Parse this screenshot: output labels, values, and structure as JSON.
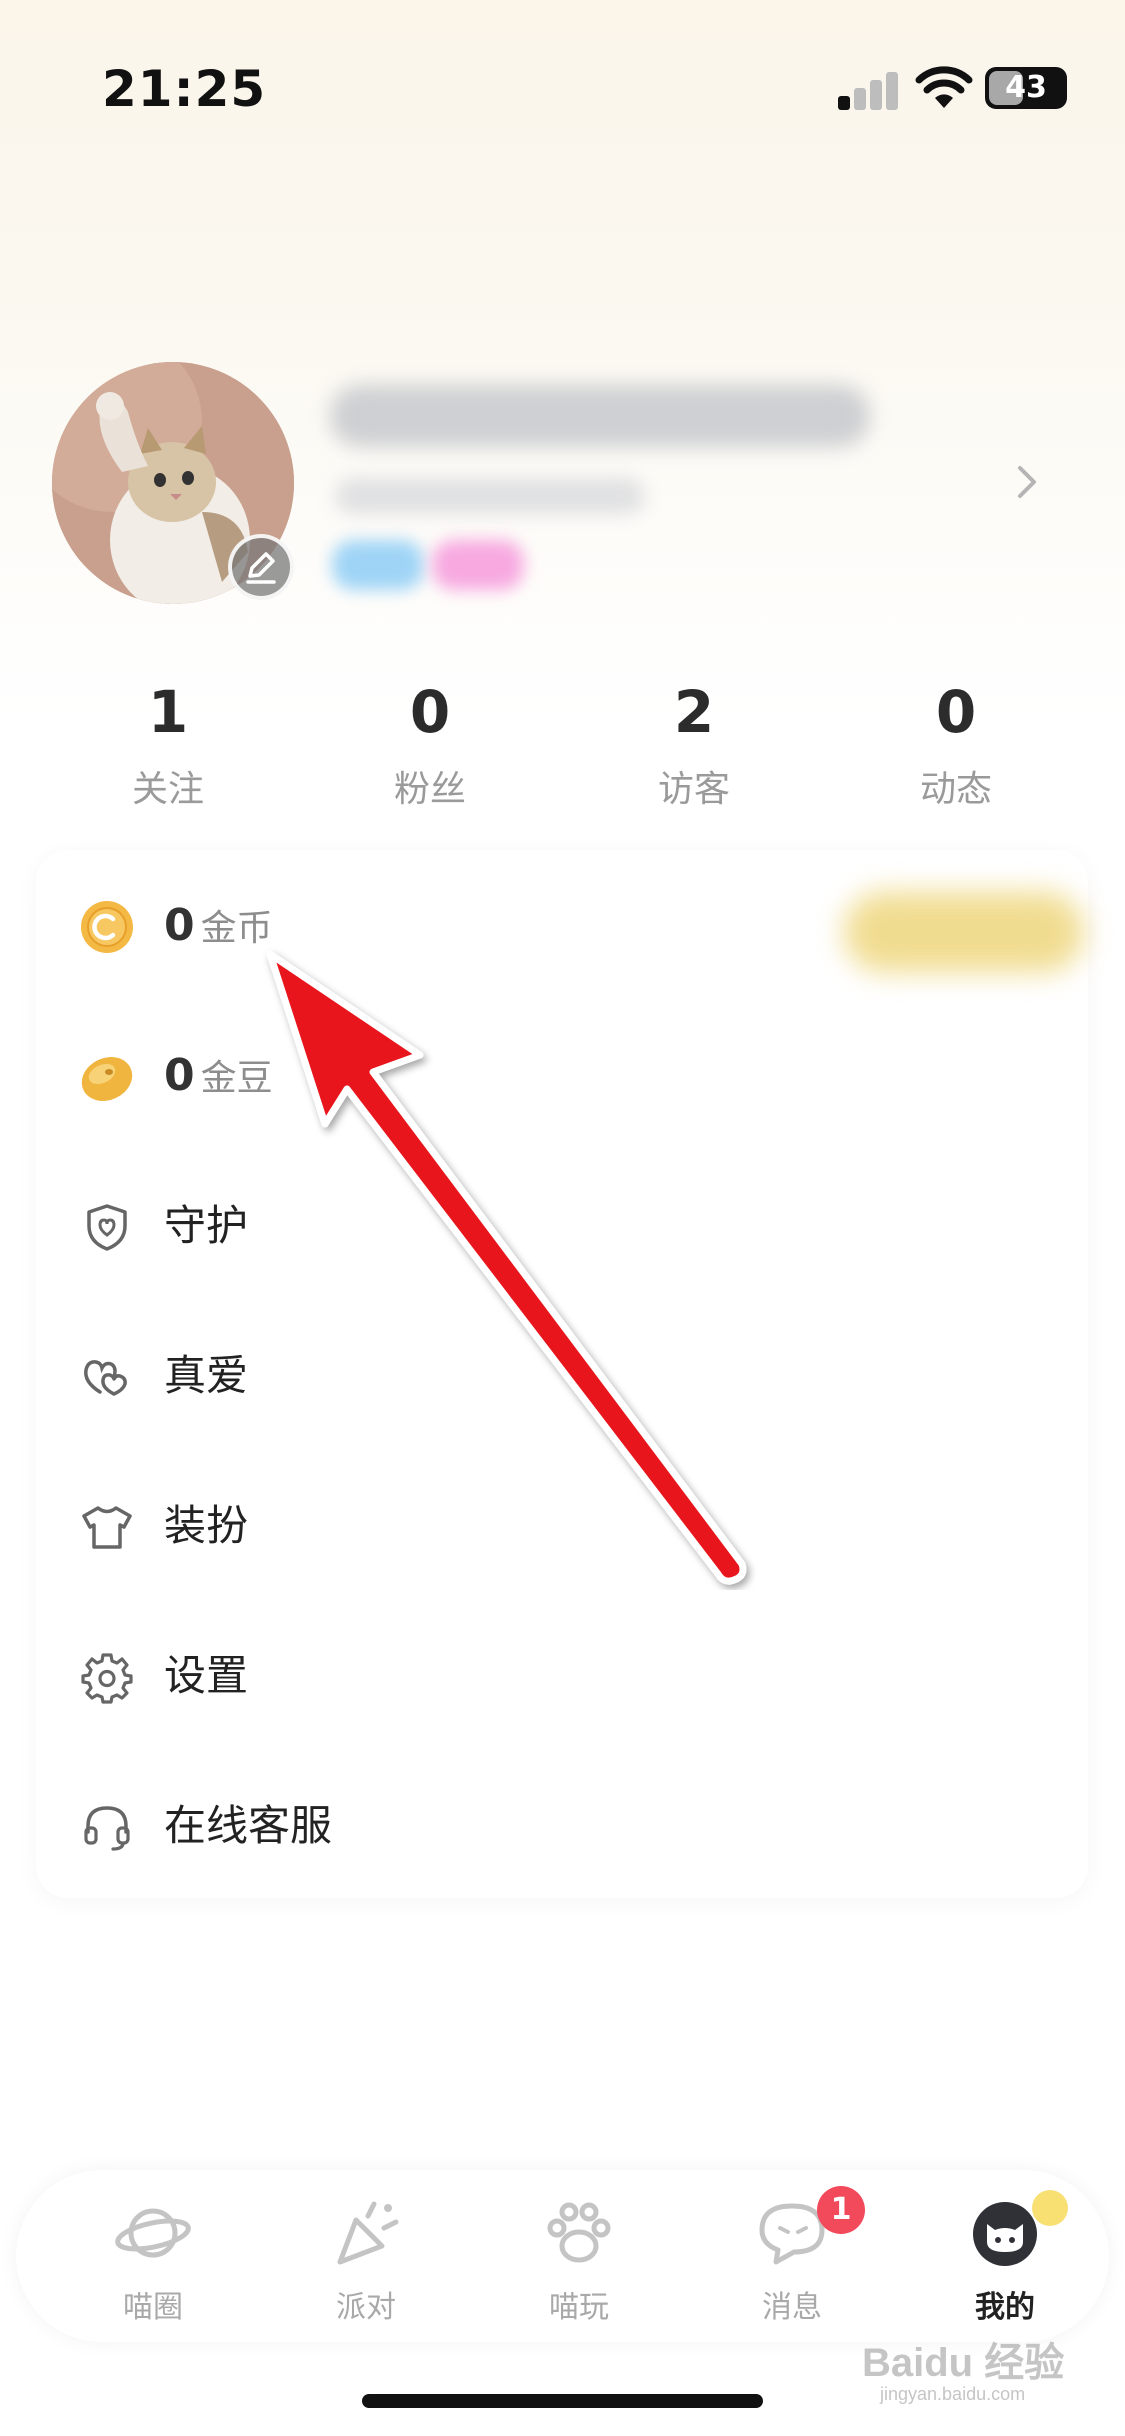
{
  "status_bar": {
    "time": "21:25",
    "battery": "43"
  },
  "stats": [
    {
      "value": "1",
      "label": "关注"
    },
    {
      "value": "0",
      "label": "粉丝"
    },
    {
      "value": "2",
      "label": "访客"
    },
    {
      "value": "0",
      "label": "动态"
    }
  ],
  "wallet": {
    "coins": {
      "value": "0",
      "unit": "金币",
      "icon": "gold-coin-icon"
    },
    "beans": {
      "value": "0",
      "unit": "金豆",
      "icon": "gold-bean-icon"
    }
  },
  "menu": [
    {
      "label": "守护",
      "icon": "shield-icon"
    },
    {
      "label": "真爱",
      "icon": "hearts-icon"
    },
    {
      "label": "装扮",
      "icon": "tshirt-icon"
    },
    {
      "label": "设置",
      "icon": "gear-icon"
    },
    {
      "label": "在线客服",
      "icon": "headset-icon"
    }
  ],
  "tabs": [
    {
      "label": "喵圈",
      "icon": "planet-icon"
    },
    {
      "label": "派对",
      "icon": "party-popper-icon"
    },
    {
      "label": "喵玩",
      "icon": "paw-icon"
    },
    {
      "label": "消息",
      "icon": "chat-bubble-icon",
      "badge": "1"
    },
    {
      "label": "我的",
      "icon": "cat-face-icon",
      "active": true
    }
  ],
  "watermark": {
    "main": "Baidu 经验",
    "sub": "jingyan.baidu.com"
  },
  "colors": {
    "badge": "#f2495b",
    "coin": "#f4b844",
    "arrow": "#e8121a"
  }
}
